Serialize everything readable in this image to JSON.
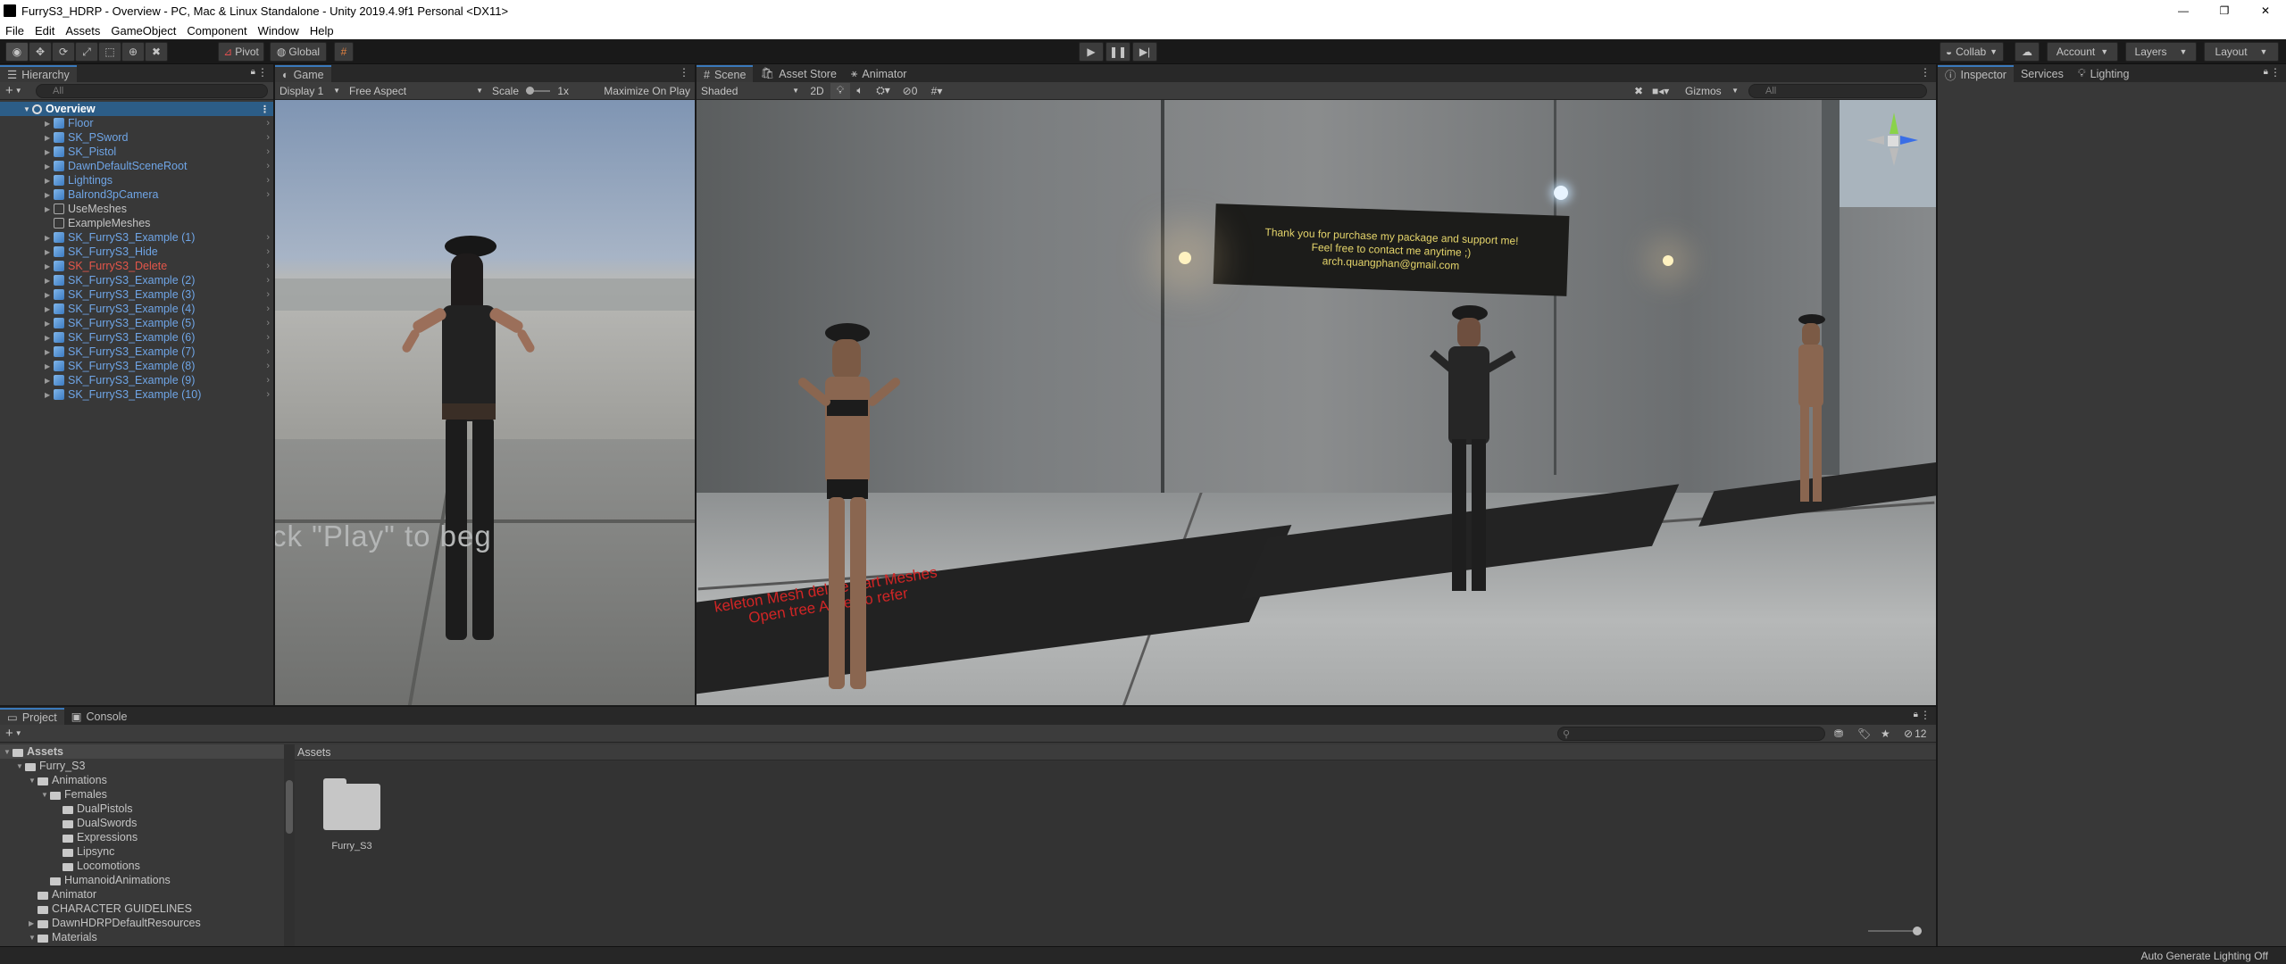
{
  "window": {
    "title": "FurryS3_HDRP - Overview - PC, Mac & Linux Standalone - Unity 2019.4.9f1 Personal <DX11>",
    "minimize": "—",
    "maximize": "❐",
    "close": "✕"
  },
  "menu": [
    "File",
    "Edit",
    "Assets",
    "GameObject",
    "Component",
    "Window",
    "Help"
  ],
  "toolbar": {
    "pivot": "Pivot",
    "global": "Global",
    "collab": "Collab",
    "account": "Account",
    "layers": "Layers",
    "layout": "Layout"
  },
  "hierarchy": {
    "tab": "Hierarchy",
    "search_placeholder": "All",
    "scene": "Overview",
    "items": [
      {
        "label": "Floor",
        "color": "blue",
        "expand": true
      },
      {
        "label": "SK_PSword",
        "color": "blue",
        "expand": true
      },
      {
        "label": "SK_Pistol",
        "color": "blue",
        "expand": true
      },
      {
        "label": "DawnDefaultSceneRoot",
        "color": "blue",
        "expand": true
      },
      {
        "label": "Lightings",
        "color": "blue",
        "expand": true
      },
      {
        "label": "Balrond3pCamera",
        "color": "blue",
        "expand": true
      },
      {
        "label": "UseMeshes",
        "color": "white",
        "expand": true
      },
      {
        "label": "ExampleMeshes",
        "color": "white",
        "expand": false
      },
      {
        "label": "SK_FurryS3_Example (1)",
        "color": "blue",
        "expand": true
      },
      {
        "label": "SK_FurryS3_Hide",
        "color": "blue",
        "expand": true
      },
      {
        "label": "SK_FurryS3_Delete",
        "color": "red",
        "expand": true
      },
      {
        "label": "SK_FurryS3_Example (2)",
        "color": "blue",
        "expand": true
      },
      {
        "label": "SK_FurryS3_Example (3)",
        "color": "blue",
        "expand": true
      },
      {
        "label": "SK_FurryS3_Example (4)",
        "color": "blue",
        "expand": true
      },
      {
        "label": "SK_FurryS3_Example (5)",
        "color": "blue",
        "expand": true
      },
      {
        "label": "SK_FurryS3_Example (6)",
        "color": "blue",
        "expand": true
      },
      {
        "label": "SK_FurryS3_Example (7)",
        "color": "blue",
        "expand": true
      },
      {
        "label": "SK_FurryS3_Example (8)",
        "color": "blue",
        "expand": true
      },
      {
        "label": "SK_FurryS3_Example (9)",
        "color": "blue",
        "expand": true
      },
      {
        "label": "SK_FurryS3_Example (10)",
        "color": "blue",
        "expand": true
      }
    ]
  },
  "game": {
    "tab": "Game",
    "display": "Display 1",
    "aspect": "Free Aspect",
    "scale_label": "Scale",
    "scale_value": "1x",
    "maximize": "Maximize On Play",
    "overlay_text": "ck \"Play\" to beg"
  },
  "scene": {
    "tabs": [
      "Scene",
      "Asset Store",
      "Animator"
    ],
    "shading": "Shaded",
    "mode2d": "2D",
    "gizmos": "Gizmos",
    "search_placeholder": "All",
    "hidden_count": "0",
    "sign_lines": [
      "Thank you for purchase my package and support me!",
      "Feel free to contact me anytime ;)",
      "arch.quangphan@gmail.com"
    ],
    "floor_red_lines": [
      "keleton Mesh delete Part Meshes",
      "Open tree Asset to refer"
    ]
  },
  "inspector": {
    "tabs": [
      "Inspector",
      "Services",
      "Lighting"
    ]
  },
  "project": {
    "tabs": [
      "Project",
      "Console"
    ],
    "hidden_count": "12",
    "breadcrumb": "Assets",
    "tree": [
      {
        "label": "Assets",
        "depth": 0,
        "arrow": "down",
        "bold": true
      },
      {
        "label": "Furry_S3",
        "depth": 1,
        "arrow": "down"
      },
      {
        "label": "Animations",
        "depth": 2,
        "arrow": "down"
      },
      {
        "label": "Females",
        "depth": 3,
        "arrow": "down"
      },
      {
        "label": "DualPistols",
        "depth": 4,
        "arrow": ""
      },
      {
        "label": "DualSwords",
        "depth": 4,
        "arrow": ""
      },
      {
        "label": "Expressions",
        "depth": 4,
        "arrow": ""
      },
      {
        "label": "Lipsync",
        "depth": 4,
        "arrow": ""
      },
      {
        "label": "Locomotions",
        "depth": 4,
        "arrow": ""
      },
      {
        "label": "HumanoidAnimations",
        "depth": 3,
        "arrow": ""
      },
      {
        "label": "Animator",
        "depth": 2,
        "arrow": ""
      },
      {
        "label": "CHARACTER GUIDELINES",
        "depth": 2,
        "arrow": ""
      },
      {
        "label": "DawnHDRPDefaultResources",
        "depth": 2,
        "arrow": "right"
      },
      {
        "label": "Materials",
        "depth": 2,
        "arrow": "down"
      }
    ],
    "grid_items": [
      {
        "label": "Furry_S3"
      }
    ]
  },
  "status": {
    "text": "Auto Generate Lighting Off"
  }
}
